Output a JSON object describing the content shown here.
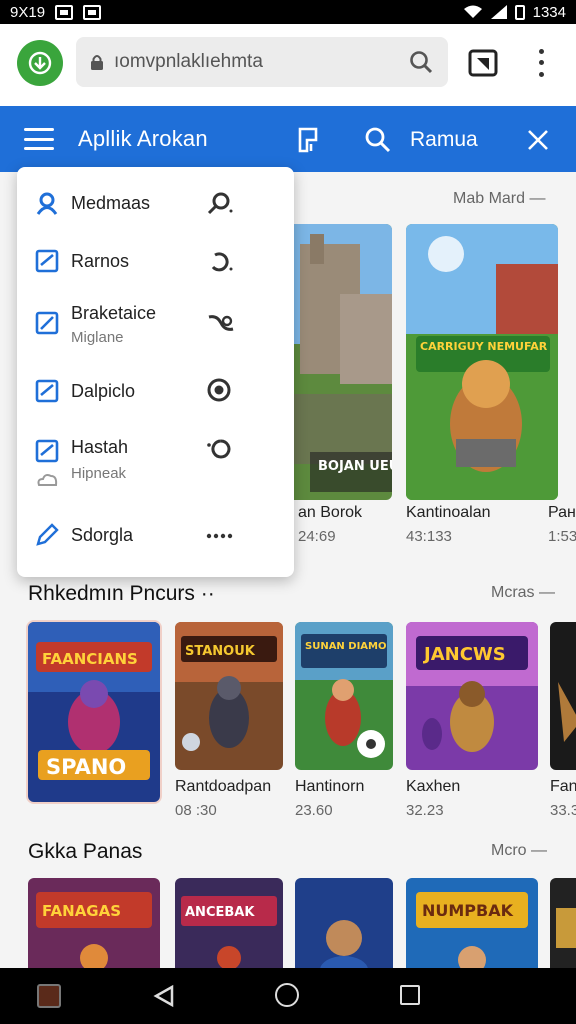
{
  "status_bar": {
    "time_left": "9X19",
    "time_right": "1334"
  },
  "browser": {
    "url": "ıomvpnlaklıehmta",
    "site_icon": "download-icon"
  },
  "app_bar": {
    "title": "Apllik Arokan",
    "search_query": "Ramua"
  },
  "drawer": {
    "items": [
      {
        "label": "Medmaas",
        "sub": "",
        "icon": "profile-icon",
        "right_icon": "search-icon"
      },
      {
        "label": "Rarnos",
        "sub": "",
        "icon": "checkbox-icon",
        "right_icon": "refresh-icon"
      },
      {
        "label": "Braketaice",
        "sub": "Miglane",
        "icon": "edit-icon",
        "right_icon": "loop-icon"
      },
      {
        "label": "Dalpiclo",
        "sub": "",
        "icon": "checkbox-icon",
        "right_icon": "target-icon"
      },
      {
        "label": "Hastah",
        "sub": "Hipneak",
        "icon": "checkbox-icon",
        "right_icon": "spinner-icon"
      },
      {
        "label": "Sdorgla",
        "sub": "",
        "icon": "pen-icon",
        "right_icon": "more-icon"
      }
    ]
  },
  "featured": {
    "more_label": "Mab Mard —",
    "items": [
      {
        "name": "an Borok",
        "meta": "24:69",
        "art_text": "BOJAN UEUH"
      },
      {
        "name": "Kantinoalan",
        "meta": "43:133",
        "art_text": "CARRIGUY NEMUFAR"
      },
      {
        "name": "Ран",
        "meta": "1:53"
      }
    ]
  },
  "section1": {
    "title": "Rhkedmın Pncurs ··",
    "more_label": "Mcras —",
    "items": [
      {
        "name": "",
        "meta": "",
        "art_text": "FAANCIANS",
        "art_sub": "SPANO"
      },
      {
        "name": "Rantdoadpan",
        "meta": "08 :30",
        "art_text": "STANOUK"
      },
      {
        "name": "Hantinorn",
        "meta": "23.60",
        "art_text": "SUNAN DIAMO"
      },
      {
        "name": "Kaxhen",
        "meta": "32.23",
        "art_text": "JANCWS"
      },
      {
        "name": "Fan",
        "meta": "33.3"
      }
    ]
  },
  "section2": {
    "title": "Gkka Panas",
    "more_label": "Mcro —",
    "items": [
      {
        "art_text": "FANAGAS"
      },
      {
        "art_text": "ANCEBAK"
      },
      {
        "art_text": ""
      },
      {
        "art_text": "NUMPBAK"
      }
    ]
  },
  "colors": {
    "app_bar": "#1f6fd8",
    "site_icon": "#3aa53c",
    "accent_icon": "#1f6fd8"
  }
}
